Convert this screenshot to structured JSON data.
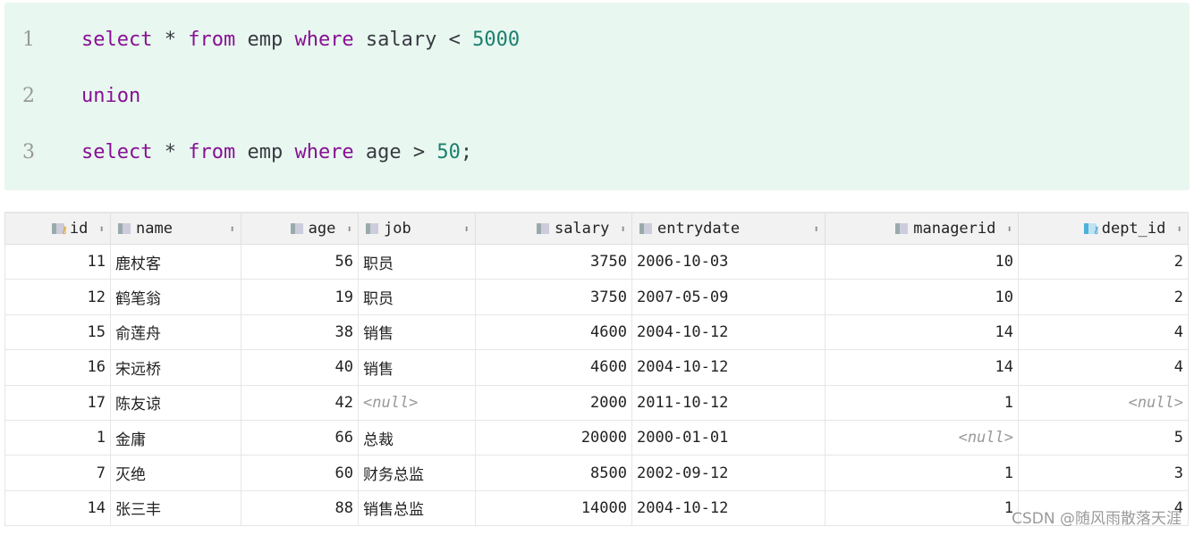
{
  "code": {
    "lines": [
      {
        "no": "1",
        "tokens": [
          [
            "kw",
            "select"
          ],
          [
            "t",
            " * "
          ],
          [
            "kw",
            "from"
          ],
          [
            "t",
            " emp "
          ],
          [
            "kw",
            "where"
          ],
          [
            "t",
            " salary < "
          ],
          [
            "num",
            "5000"
          ]
        ]
      },
      {
        "no": "2",
        "tokens": [
          [
            "kw",
            "union"
          ]
        ]
      },
      {
        "no": "3",
        "tokens": [
          [
            "kw",
            "select"
          ],
          [
            "t",
            " * "
          ],
          [
            "kw",
            "from"
          ],
          [
            "t",
            " emp "
          ],
          [
            "kw",
            "where"
          ],
          [
            "t",
            " age > "
          ],
          [
            "num",
            "50"
          ],
          [
            "t",
            ";"
          ]
        ]
      }
    ]
  },
  "table": {
    "columns": [
      {
        "label": "id",
        "icon": "primary-key-column-icon",
        "align": "right",
        "width": 118
      },
      {
        "label": "name",
        "icon": "column-icon",
        "align": "left",
        "width": 146
      },
      {
        "label": "age",
        "icon": "column-icon",
        "align": "right",
        "width": 131
      },
      {
        "label": "job",
        "icon": "column-icon",
        "align": "left",
        "width": 131
      },
      {
        "label": "salary",
        "icon": "column-icon",
        "align": "right",
        "width": 175
      },
      {
        "label": "entrydate",
        "icon": "column-icon",
        "align": "left",
        "width": 216
      },
      {
        "label": "managerid",
        "icon": "column-icon",
        "align": "right",
        "width": 216
      },
      {
        "label": "dept_id",
        "icon": "foreign-key-column-icon",
        "align": "right",
        "width": 190
      }
    ],
    "rows": [
      [
        "11",
        "鹿杖客",
        "56",
        "职员",
        "3750",
        "2006-10-03",
        "10",
        "2"
      ],
      [
        "12",
        "鹤笔翁",
        "19",
        "职员",
        "3750",
        "2007-05-09",
        "10",
        "2"
      ],
      [
        "15",
        "俞莲舟",
        "38",
        "销售",
        "4600",
        "2004-10-12",
        "14",
        "4"
      ],
      [
        "16",
        "宋远桥",
        "40",
        "销售",
        "4600",
        "2004-10-12",
        "14",
        "4"
      ],
      [
        "17",
        "陈友谅",
        "42",
        "<null>",
        "2000",
        "2011-10-12",
        "1",
        "<null>"
      ],
      [
        "1",
        "金庸",
        "66",
        "总裁",
        "20000",
        "2000-01-01",
        "<null>",
        "5"
      ],
      [
        "7",
        "灭绝",
        "60",
        "财务总监",
        "8500",
        "2002-09-12",
        "1",
        "3"
      ],
      [
        "14",
        "张三丰",
        "88",
        "销售总监",
        "14000",
        "2004-10-12",
        "1",
        "4"
      ]
    ]
  },
  "watermark": "CSDN @随风雨散落天涯"
}
